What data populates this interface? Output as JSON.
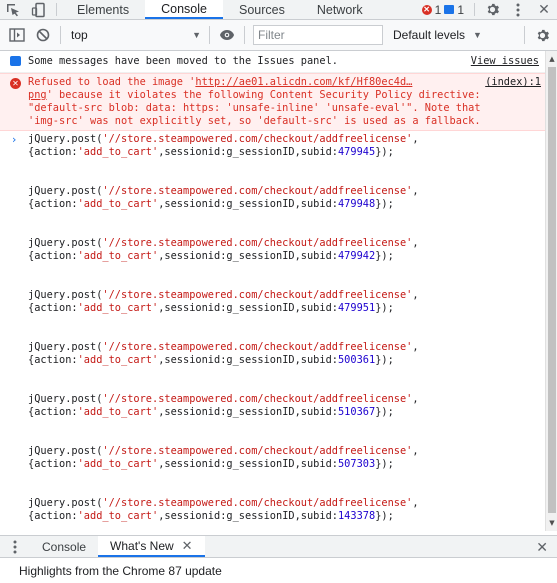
{
  "devtools_tabs": [
    "Elements",
    "Console",
    "Sources",
    "Network"
  ],
  "issue_counts": {
    "errors": "1",
    "messages": "1"
  },
  "toolbar": {
    "context": "top",
    "filter_placeholder": "Filter",
    "levels_label": "Default levels"
  },
  "info_message": {
    "text": "Some messages have been moved to the Issues panel.",
    "link": "View issues"
  },
  "error_message": {
    "prefix": "Refused to load the image '",
    "url": "http://ae01.alicdn.com/kf/Hf80ec4d…",
    "source": "(index):1",
    "line1_end": "png",
    "line1_rest": "' because it violates the following Content Security Policy directive:",
    "line2": "\"default-src blob: data: https: 'unsafe-inline' 'unsafe-eval'\". Note that",
    "line3": "'img-src' was not explicitly set, so 'default-src' is used as a fallback."
  },
  "code_entries": [
    {
      "call": "jQuery.post(",
      "url": "'//store.steampowered.com/checkout/addfreelicense'",
      "args_a": "{action:",
      "action": "'add_to_cart'",
      "args_b": ",sessionid:g_sessionID,subid:",
      "subid": "479945",
      "end": "});"
    },
    {
      "call": "jQuery.post(",
      "url": "'//store.steampowered.com/checkout/addfreelicense'",
      "args_a": "{action:",
      "action": "'add_to_cart'",
      "args_b": ",sessionid:g_sessionID,subid:",
      "subid": "479948",
      "end": "});"
    },
    {
      "call": "jQuery.post(",
      "url": "'//store.steampowered.com/checkout/addfreelicense'",
      "args_a": "{action:",
      "action": "'add_to_cart'",
      "args_b": ",sessionid:g_sessionID,subid:",
      "subid": "479942",
      "end": "});"
    },
    {
      "call": "jQuery.post(",
      "url": "'//store.steampowered.com/checkout/addfreelicense'",
      "args_a": "{action:",
      "action": "'add_to_cart'",
      "args_b": ",sessionid:g_sessionID,subid:",
      "subid": "479951",
      "end": "});"
    },
    {
      "call": "jQuery.post(",
      "url": "'//store.steampowered.com/checkout/addfreelicense'",
      "args_a": "{action:",
      "action": "'add_to_cart'",
      "args_b": ",sessionid:g_sessionID,subid:",
      "subid": "500361",
      "end": "});"
    },
    {
      "call": "jQuery.post(",
      "url": "'//store.steampowered.com/checkout/addfreelicense'",
      "args_a": "{action:",
      "action": "'add_to_cart'",
      "args_b": ",sessionid:g_sessionID,subid:",
      "subid": "510367",
      "end": "});"
    },
    {
      "call": "jQuery.post(",
      "url": "'//store.steampowered.com/checkout/addfreelicense'",
      "args_a": "{action:",
      "action": "'add_to_cart'",
      "args_b": ",sessionid:g_sessionID,subid:",
      "subid": "507303",
      "end": "});"
    },
    {
      "call": "jQuery.post(",
      "url": "'//store.steampowered.com/checkout/addfreelicense'",
      "args_a": "{action:",
      "action": "'add_to_cart'",
      "args_b": ",sessionid:g_sessionID,subid:",
      "subid": "143378",
      "end": "});"
    }
  ],
  "drawer": {
    "tabs": [
      "Console",
      "What's New"
    ],
    "content": "Highlights from the Chrome 87 update"
  },
  "colors": {
    "accent": "#1a73e8",
    "error": "#d93025",
    "string": "#c41a16",
    "number": "#1c00cf"
  },
  "icons": [
    "inspect-icon",
    "device-toolbar-icon",
    "settings-gear-icon",
    "more-vert-icon",
    "sidebar-toggle-icon",
    "clear-console-icon",
    "eye-icon",
    "close-icon"
  ]
}
